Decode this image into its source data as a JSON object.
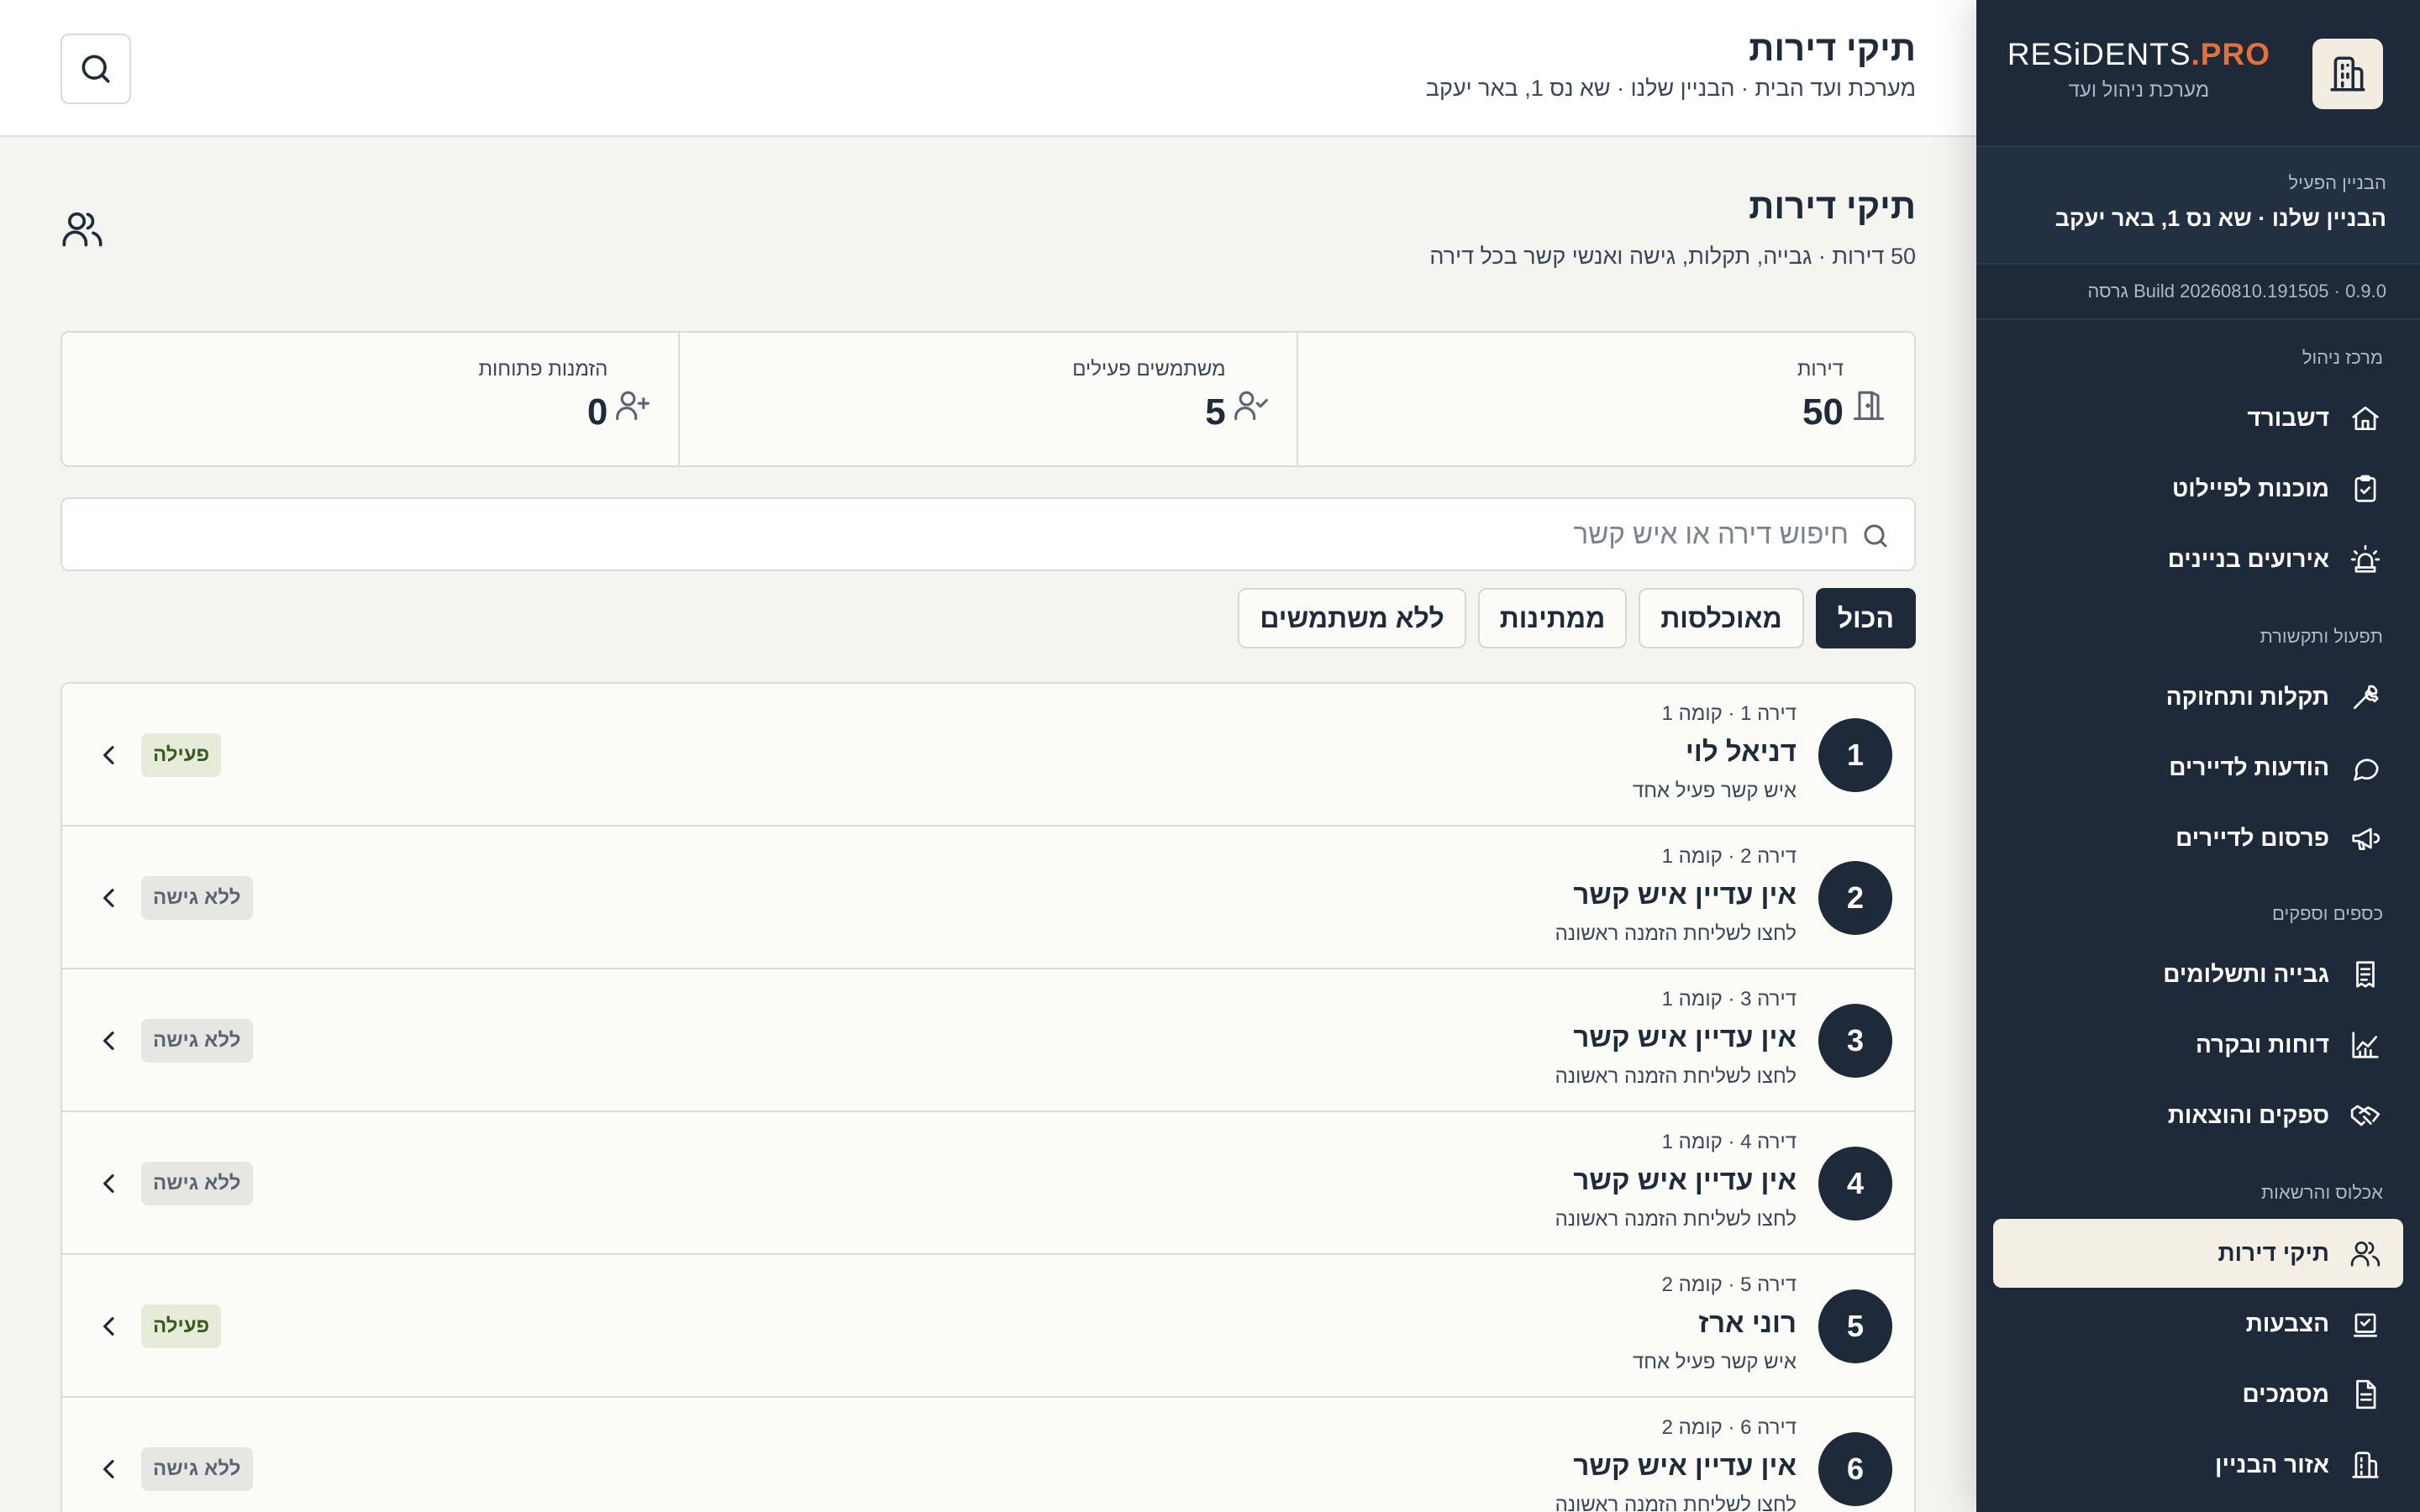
{
  "sidebar": {
    "logo": {
      "main": "RESiDENTS",
      "accent": ".PRO",
      "sub": "מערכת ניהול ועד"
    },
    "building": {
      "label": "הבניין הפעיל",
      "name": "הבניין שלנו · שא נס 1, באר יעקב"
    },
    "version": "Build 20260810.191505 · 0.9.0 גרסה",
    "sections": {
      "management": "מרכז ניהול",
      "operations": "תפעול ותקשורת",
      "finance": "כספים וספקים",
      "occupancy": "אכלוס והרשאות"
    },
    "items": [
      {
        "label": "דשבורד",
        "icon": "home-icon"
      },
      {
        "label": "מוכנות לפיילוט",
        "icon": "clipboard-check-icon"
      },
      {
        "label": "אירועים בניינים",
        "icon": "siren-icon"
      },
      {
        "label": "תקלות ותחזוקה",
        "icon": "wrench-icon"
      },
      {
        "label": "הודעות לדיירים",
        "icon": "chat-bubble-icon"
      },
      {
        "label": "פרסום לדיירים",
        "icon": "megaphone-icon"
      },
      {
        "label": "גבייה ותשלומים",
        "icon": "receipt-icon"
      },
      {
        "label": "דוחות ובקרה",
        "icon": "chart-line-icon"
      },
      {
        "label": "ספקים והוצאות",
        "icon": "handshake-icon"
      },
      {
        "label": "תיקי דירות",
        "icon": "users-icon",
        "active": true
      },
      {
        "label": "הצבעות",
        "icon": "vote-icon"
      },
      {
        "label": "מסמכים",
        "icon": "document-icon"
      },
      {
        "label": "אזור הבניין",
        "icon": "building-icon"
      }
    ]
  },
  "topbar": {
    "title": "תיקי דירות",
    "subtitle": "מערכת ועד הבית · הבניין שלנו · שא נס 1, באר יעקב"
  },
  "page": {
    "title": "תיקי דירות",
    "subtitle": "50 דירות · גבייה, תקלות, גישה ואנשי קשר בכל דירה"
  },
  "stats": [
    {
      "label": "דירות",
      "value": "50",
      "icon": "door-icon"
    },
    {
      "label": "משתמשים פעילים",
      "value": "5",
      "icon": "user-check-icon"
    },
    {
      "label": "הזמנות פתוחות",
      "value": "0",
      "icon": "user-plus-icon"
    }
  ],
  "search": {
    "placeholder": "חיפוש דירה או איש קשר",
    "value": ""
  },
  "filters": [
    {
      "label": "הכול",
      "active": true
    },
    {
      "label": "מאוכלסות"
    },
    {
      "label": "ממתינות"
    },
    {
      "label": "ללא משתמשים"
    }
  ],
  "apartments": [
    {
      "num": "1",
      "meta": "דירה 1 · קומה 1",
      "name": "דניאל לוי",
      "hint": "איש קשר פעיל אחד",
      "status": "פעילה"
    },
    {
      "num": "2",
      "meta": "דירה 2 · קומה 1",
      "name": "אין עדיין איש קשר",
      "hint": "לחצו לשליחת הזמנה ראשונה",
      "status": "ללא גישה"
    },
    {
      "num": "3",
      "meta": "דירה 3 · קומה 1",
      "name": "אין עדיין איש קשר",
      "hint": "לחצו לשליחת הזמנה ראשונה",
      "status": "ללא גישה"
    },
    {
      "num": "4",
      "meta": "דירה 4 · קומה 1",
      "name": "אין עדיין איש קשר",
      "hint": "לחצו לשליחת הזמנה ראשונה",
      "status": "ללא גישה"
    },
    {
      "num": "5",
      "meta": "דירה 5 · קומה 2",
      "name": "רוני ארז",
      "hint": "איש קשר פעיל אחד",
      "status": "פעילה"
    },
    {
      "num": "6",
      "meta": "דירה 6 · קומה 2",
      "name": "אין עדיין איש קשר",
      "hint": "לחצו לשליחת הזמנה ראשונה",
      "status": "ללא גישה"
    }
  ],
  "colors": {
    "navy": "#1e2a39",
    "accent": "#e5713a",
    "active_bg": "#f4efe4",
    "badge_active_bg": "#e6ecd9",
    "badge_inactive_bg": "#e6e7e3"
  }
}
